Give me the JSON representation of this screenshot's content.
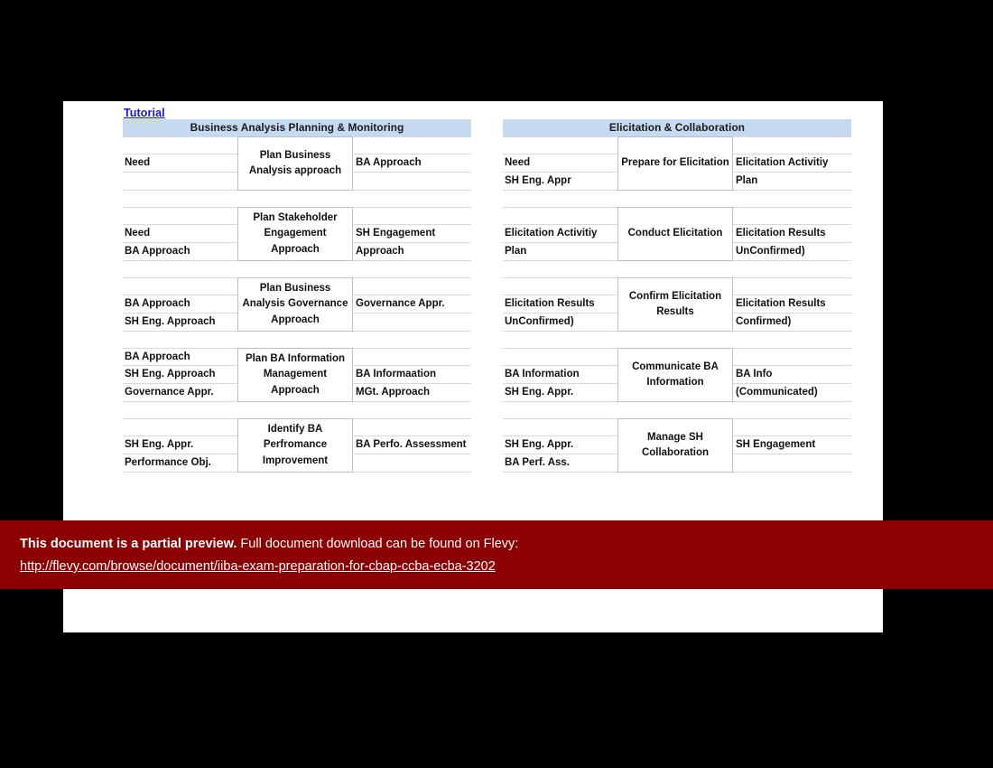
{
  "tutorial_link": "Tutorial",
  "columns": [
    {
      "id": "business-analysis-planning-monitoring",
      "header": "Business Analysis Planning & Monitoring",
      "groups": [
        {
          "process": "Plan Business Analysis approach",
          "inputs": [
            "",
            "Need",
            ""
          ],
          "outputs": [
            "",
            "BA Approach",
            ""
          ]
        },
        {
          "process": "Plan Stakeholder Engagement Approach",
          "inputs": [
            "",
            "Need",
            "BA Approach"
          ],
          "outputs": [
            "",
            "SH Engagement",
            "Approach"
          ]
        },
        {
          "process": "Plan Business Analysis Governance Approach",
          "inputs": [
            "",
            "BA Approach",
            "SH Eng. Approach"
          ],
          "outputs": [
            "",
            "Governance Appr.",
            ""
          ]
        },
        {
          "process": "Plan BA Information Management Approach",
          "inputs": [
            "BA Approach",
            "SH Eng. Approach",
            "Governance Appr."
          ],
          "outputs": [
            "",
            "BA Informaation",
            "MGt. Approach"
          ]
        },
        {
          "process": "Identify BA Perfromance Improvement",
          "inputs": [
            "",
            "SH Eng. Appr.",
            "Performance Obj."
          ],
          "outputs": [
            "",
            "BA Perfo. Assessment",
            ""
          ]
        }
      ]
    },
    {
      "id": "elicitation-collaboration",
      "header": "Elicitation & Collaboration",
      "groups": [
        {
          "process": "Prepare for Elicitation",
          "inputs": [
            "",
            "Need",
            "SH Eng. Appr"
          ],
          "outputs": [
            "",
            "Elicitation Activitiy",
            "Plan"
          ]
        },
        {
          "process": "Conduct Elicitation",
          "inputs": [
            "",
            "Elicitation Activitiy",
            "Plan"
          ],
          "outputs": [
            "",
            "Elicitation Results",
            "UnConfirmed)"
          ]
        },
        {
          "process": "Confirm Elicitation Results",
          "inputs": [
            "",
            "Elicitation Results",
            "UnConfirmed)"
          ],
          "outputs": [
            "",
            "Elicitation Results",
            "Confirmed)"
          ]
        },
        {
          "process": "Communicate BA Information",
          "inputs": [
            "",
            "BA Information",
            "SH Eng. Appr."
          ],
          "outputs": [
            "",
            "BA Info",
            "(Communicated)"
          ]
        },
        {
          "process": "Manage SH Collaboration",
          "inputs": [
            "",
            "SH Eng. Appr.",
            "BA Perf. Ass."
          ],
          "outputs": [
            "",
            "SH Engagement",
            ""
          ]
        }
      ]
    }
  ],
  "banner": {
    "bold_text": "This document is a partial preview.",
    "rest_text": "Full document download can be found on Flevy:",
    "url": "http://flevy.com/browse/document/iiba-exam-preparation-for-cbap-ccba-ecba-3202"
  },
  "colors": {
    "header_band": "#c5d9f1",
    "banner_red": "#8b0000",
    "link_blue": "#1414cc",
    "grid_line": "#d9d9d9",
    "box_border": "#bfbfbf"
  }
}
